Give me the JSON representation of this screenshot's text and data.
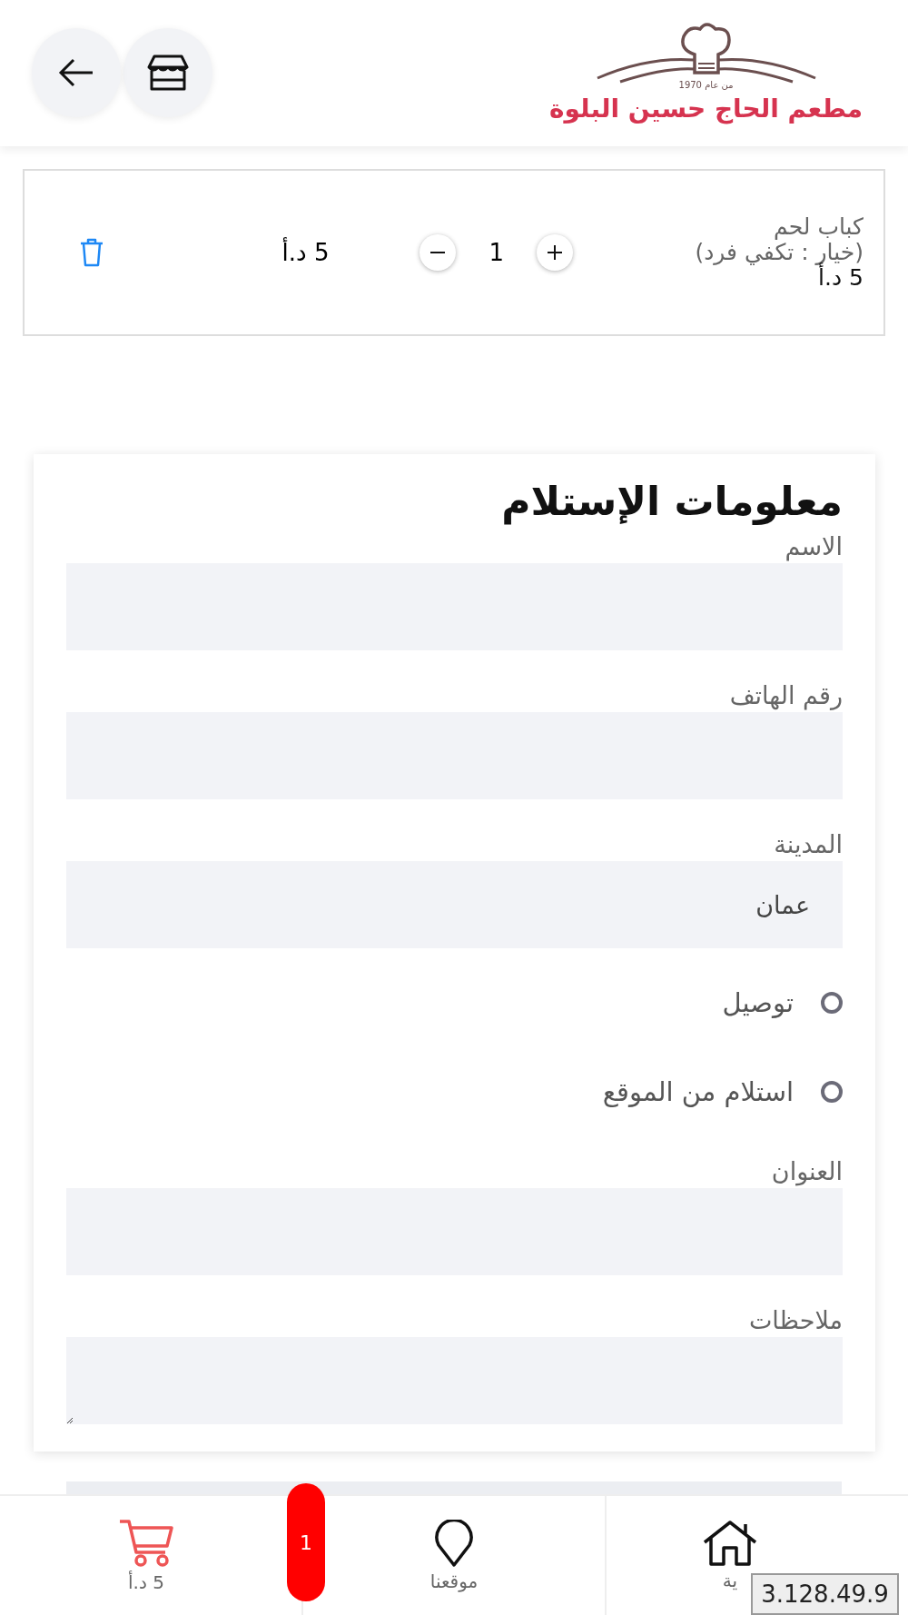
{
  "header": {
    "logo": {
      "since": "من عام 1970",
      "name": "مطعم الحاج حسين البلوة"
    },
    "buttons": [
      {
        "kind": "store"
      },
      {
        "kind": "back"
      }
    ]
  },
  "cart_items": [
    {
      "name": "كباب لحم",
      "option": "(خيار : تكفي فرد)",
      "unit_price": "5 د.أ",
      "quantity": "1",
      "total": "5 د.أ"
    }
  ],
  "form": {
    "title": "معلومات الإستلام",
    "fields": [
      {
        "kind": "text",
        "label": "الاسم"
      },
      {
        "kind": "text",
        "label": "رقم الهاتف"
      },
      {
        "kind": "select",
        "label": "المدينة",
        "value": "عمان"
      },
      {
        "kind": "radio",
        "label": "توصيل",
        "selected": false
      },
      {
        "kind": "radio",
        "label": "استلام من الموقع",
        "selected": false
      },
      {
        "kind": "text",
        "label": "العنوان"
      },
      {
        "kind": "textarea",
        "label": "ملاحظات"
      }
    ]
  },
  "bottom_nav": [
    {
      "kind": "home",
      "label": "ية"
    },
    {
      "kind": "location",
      "label": "موقعنا"
    },
    {
      "kind": "cart",
      "label": "5 د.أ",
      "badge": "1"
    }
  ],
  "ip_overlay": "3.128.49.9"
}
